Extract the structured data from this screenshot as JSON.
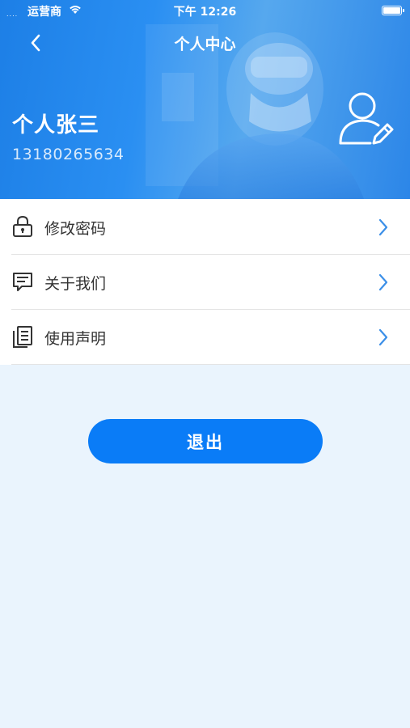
{
  "status_bar": {
    "signal_dots": "....",
    "carrier": "运营商",
    "time": "下午 12:26",
    "wifi_icon": "wifi-icon",
    "battery_icon": "battery-icon"
  },
  "nav": {
    "title": "个人中心",
    "back_icon": "chevron-left-icon"
  },
  "profile": {
    "name": "个人张三",
    "phone": "13180265634",
    "edit_icon": "user-edit-icon"
  },
  "menu": {
    "items": [
      {
        "label": "修改密码",
        "icon": "lock-icon"
      },
      {
        "label": "关于我们",
        "icon": "message-icon"
      },
      {
        "label": "使用声明",
        "icon": "document-icon"
      }
    ],
    "arrow_icon": "chevron-right-icon"
  },
  "logout": {
    "label": "退出"
  },
  "colors": {
    "brand_blue": "#0a7cf7",
    "page_background": "#eaf4fd",
    "arrow_blue": "#3b8fe8"
  }
}
